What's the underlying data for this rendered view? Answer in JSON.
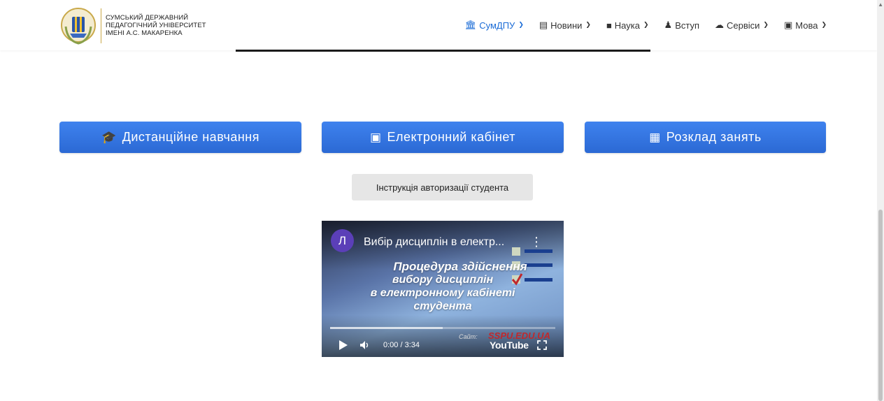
{
  "header": {
    "logo_lines": [
      "СУМСЬКИЙ ДЕРЖАВНИЙ",
      "ПЕДАГОГІЧНИЙ УНІВЕРСИТЕТ",
      "ІМЕНІ А.С. МАКАРЕНКА"
    ],
    "nav": [
      {
        "label": "СумДПУ",
        "icon": "institution-icon",
        "active": true
      },
      {
        "label": "Новини",
        "icon": "newspaper-icon"
      },
      {
        "label": "Наука",
        "icon": "book-icon"
      },
      {
        "label": "Вступ",
        "icon": "person-icon"
      },
      {
        "label": "Сервіси",
        "icon": "cloud-icon"
      },
      {
        "label": "Мова",
        "icon": "language-icon"
      }
    ]
  },
  "main": {
    "buttons": [
      {
        "label": "Дистанційне навчання",
        "icon": "graduate-icon"
      },
      {
        "label": "Електронний кабінет",
        "icon": "id-card-icon"
      },
      {
        "label": "Розклад занять",
        "icon": "calendar-icon"
      }
    ],
    "instruction_label": "Інструкція авторизації студента"
  },
  "video": {
    "avatar_letter": "Л",
    "title": "Вибір дисциплін в електр...",
    "caption": [
      "Процедура здійснення",
      "вибору дисциплін",
      "в електронному кабінеті",
      "студента"
    ],
    "time": "0:00 / 3:34",
    "site_label": "Сайт:",
    "site_url": "SSPU.EDU.UA",
    "youtube_label": "YouTube",
    "progress": 0.5
  },
  "colors": {
    "accent": "#1a6bd6",
    "button_blue": "#2f6fdc"
  }
}
